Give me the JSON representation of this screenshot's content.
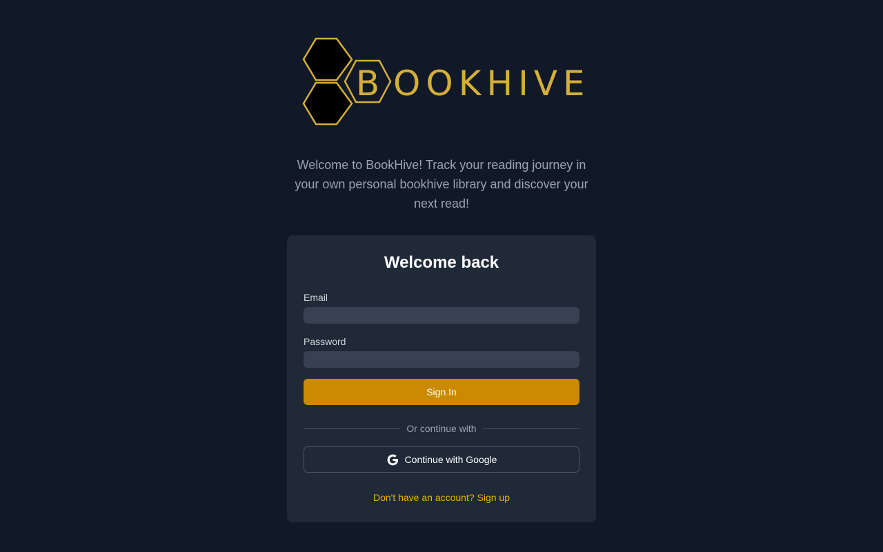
{
  "brand": {
    "initial": "B",
    "rest": "OOKHIVE",
    "accent_color": "#d4af37"
  },
  "tagline": "Welcome to BookHive! Track your reading journey in your own personal bookhive library and discover your next read!",
  "login": {
    "title": "Welcome back",
    "email_label": "Email",
    "email_value": "",
    "password_label": "Password",
    "password_value": "",
    "signin_label": "Sign In",
    "divider_text": "Or continue with",
    "google_label": "Continue with Google",
    "signup_text": "Don't have an account? Sign up"
  },
  "icons": {
    "google": "google-icon",
    "logo": "hexagon-logo-icon"
  },
  "colors": {
    "background": "#111827",
    "card": "#1f2937",
    "input": "#374151",
    "primary_button": "#ca8a04",
    "link": "#eab308"
  }
}
